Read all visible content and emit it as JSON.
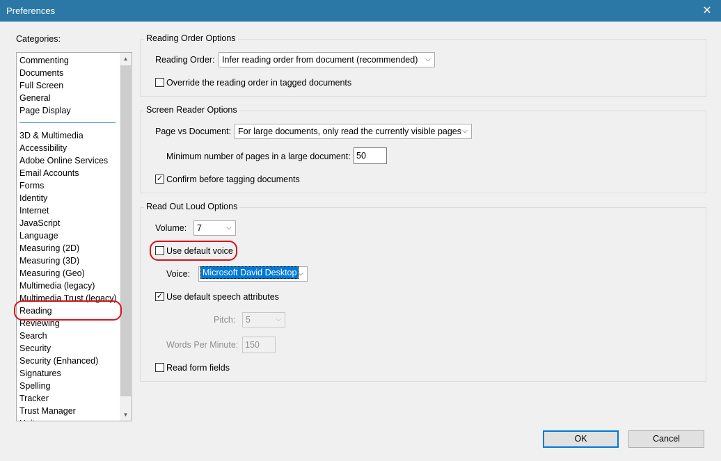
{
  "window": {
    "title": "Preferences",
    "close_glyph": "✕"
  },
  "categories": {
    "label": "Categories:",
    "top_items": [
      "Commenting",
      "Documents",
      "Full Screen",
      "General",
      "Page Display"
    ],
    "items": [
      "3D & Multimedia",
      "Accessibility",
      "Adobe Online Services",
      "Email Accounts",
      "Forms",
      "Identity",
      "Internet",
      "JavaScript",
      "Language",
      "Measuring (2D)",
      "Measuring (3D)",
      "Measuring (Geo)",
      "Multimedia (legacy)",
      "Multimedia Trust (legacy)",
      "Reading",
      "Reviewing",
      "Search",
      "Security",
      "Security (Enhanced)",
      "Signatures",
      "Spelling",
      "Tracker",
      "Trust Manager",
      "Units"
    ],
    "selected": "Reading"
  },
  "reading_order": {
    "group_title": "Reading Order Options",
    "label": "Reading Order:",
    "value": "Infer reading order from document (recommended)",
    "override_label": "Override the reading order in tagged documents",
    "override_checked": false
  },
  "screen_reader": {
    "group_title": "Screen Reader Options",
    "page_vs_doc_label": "Page vs Document:",
    "page_vs_doc_value": "For large documents, only read the currently visible pages",
    "min_pages_label": "Minimum number of pages in a large document:",
    "min_pages_value": "50",
    "confirm_label": "Confirm before tagging documents",
    "confirm_checked": true
  },
  "read_out_loud": {
    "group_title": "Read Out Loud Options",
    "volume_label": "Volume:",
    "volume_value": "7",
    "default_voice_label": "Use default voice",
    "default_voice_checked": false,
    "voice_label": "Voice:",
    "voice_value": "Microsoft David Desktop",
    "speech_attr_label": "Use default speech attributes",
    "speech_attr_checked": true,
    "pitch_label": "Pitch:",
    "pitch_value": "5",
    "wpm_label": "Words Per Minute:",
    "wpm_value": "150",
    "form_fields_label": "Read form fields",
    "form_fields_checked": false
  },
  "buttons": {
    "ok": "OK",
    "cancel": "Cancel"
  },
  "colors": {
    "titlebar": "#2b78a6",
    "highlight": "#d9131a",
    "selection": "#0078d7"
  }
}
